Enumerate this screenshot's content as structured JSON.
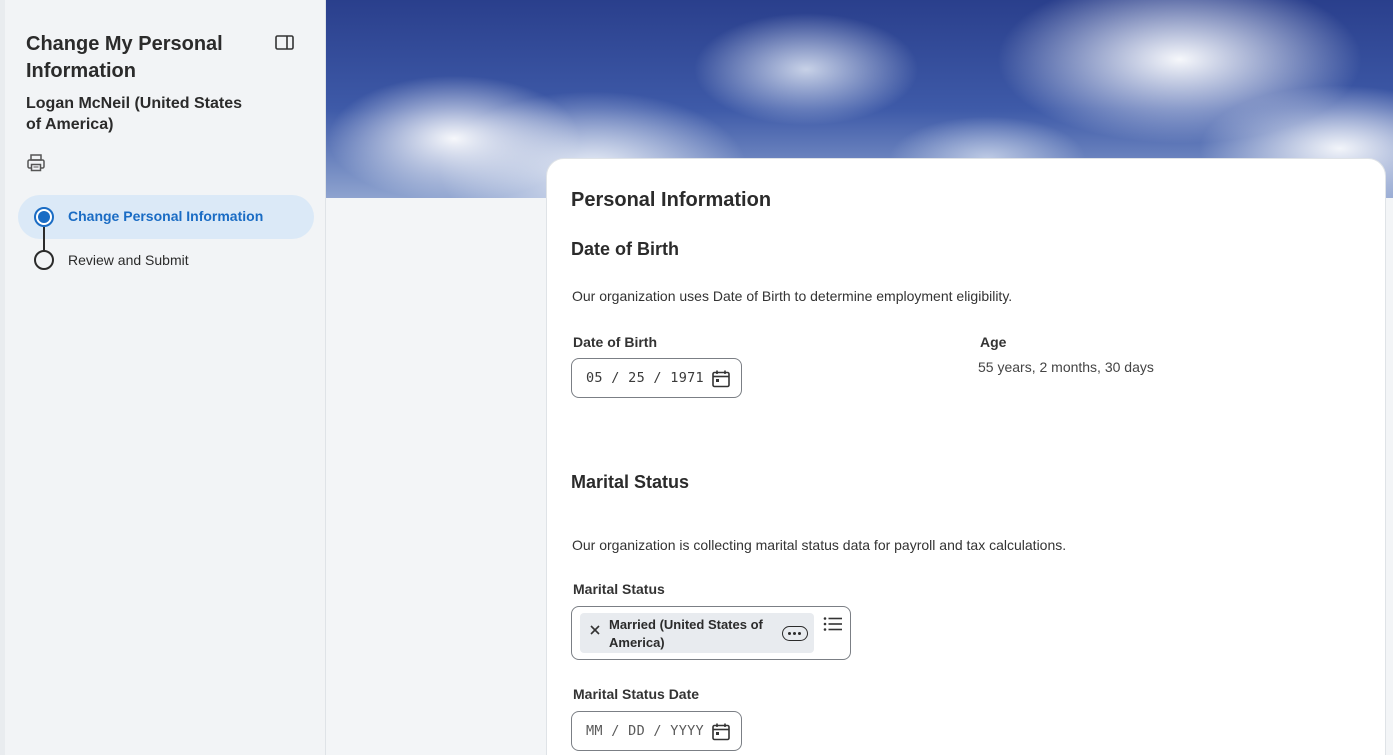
{
  "sidebar": {
    "title": "Change My Personal Information",
    "subtitle": "Logan McNeil (United States of America)",
    "steps": [
      {
        "label": "Change Personal Information",
        "active": true
      },
      {
        "label": "Review and Submit",
        "active": false
      }
    ]
  },
  "card": {
    "title": "Personal Information",
    "dob_section": {
      "title": "Date of Birth",
      "description": "Our organization uses Date of Birth to determine employment eligibility.",
      "field_label": "Date of Birth",
      "value": "05 / 25 / 1971",
      "age_label": "Age",
      "age_value": "55 years, 2 months, 30 days"
    },
    "marital_section": {
      "title": "Marital Status",
      "description": "Our organization is collecting marital status data for payroll and tax calculations.",
      "field_label": "Marital Status",
      "selected": "Married (United States of America)",
      "date_label": "Marital Status Date",
      "date_placeholder": "MM / DD / YYYY"
    }
  },
  "colors": {
    "accent": "#1a6cc4",
    "active_step_bg": "#dbe9f7",
    "sidebar_bg": "#f2f4f6",
    "card_bg": "#ffffff"
  },
  "icons": [
    "panel-toggle-icon",
    "print-icon",
    "calendar-icon",
    "close-icon",
    "more-options-icon",
    "list-icon"
  ]
}
